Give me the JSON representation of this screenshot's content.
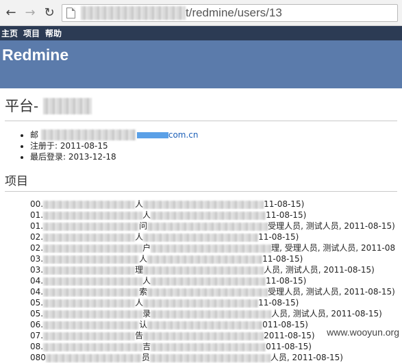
{
  "browser": {
    "url_suffix": "t/redmine/users/13"
  },
  "top_menu": [
    "主页",
    "项目",
    "帮助"
  ],
  "app_title": "Redmine",
  "user_title": "平台-",
  "profile": {
    "email_prefix": "邮",
    "email_suffix": "com.cn",
    "registered": "注册于: 2011-08-15",
    "last_login": "最后登录: 2013-12-18"
  },
  "projects_title": "项目",
  "projects": [
    {
      "prefix": "00.",
      "mid": "人",
      "tail": "11-08-15)"
    },
    {
      "prefix": "01.",
      "mid": "人",
      "tail": "11-08-15)"
    },
    {
      "prefix": "01.",
      "mid": "问",
      "tail": "受理人员, 测试人员, 2011-08-15)"
    },
    {
      "prefix": "02.",
      "mid": "人",
      "tail": "11-08-15)"
    },
    {
      "prefix": "02.",
      "mid": "户",
      "tail": "理, 受理人员, 测试人员, 2011-08"
    },
    {
      "prefix": "03.",
      "mid": "人",
      "tail": "11-08-15)"
    },
    {
      "prefix": "03.",
      "mid": "理",
      "tail": "人员, 测试人员, 2011-08-15)"
    },
    {
      "prefix": "04.",
      "mid": "人",
      "tail": "11-08-15)"
    },
    {
      "prefix": "04.",
      "mid": "索",
      "tail": "受理人员, 测试人员, 2011-08-15)"
    },
    {
      "prefix": "05.",
      "mid": "人",
      "tail": "11-08-15)"
    },
    {
      "prefix": "05.",
      "mid": "录",
      "tail": "人员, 测试人员, 2011-08-15)"
    },
    {
      "prefix": "06.",
      "mid": "认",
      "tail": "011-08-15)"
    },
    {
      "prefix": "07.",
      "mid": "告",
      "tail": "2011-08-15)"
    },
    {
      "prefix": "08.",
      "mid": "吉",
      "tail": "011-08-15)"
    },
    {
      "prefix": "080",
      "mid": "员",
      "tail": "人员, 2011-08-15)"
    }
  ],
  "watermark": "www.wooyun.org"
}
